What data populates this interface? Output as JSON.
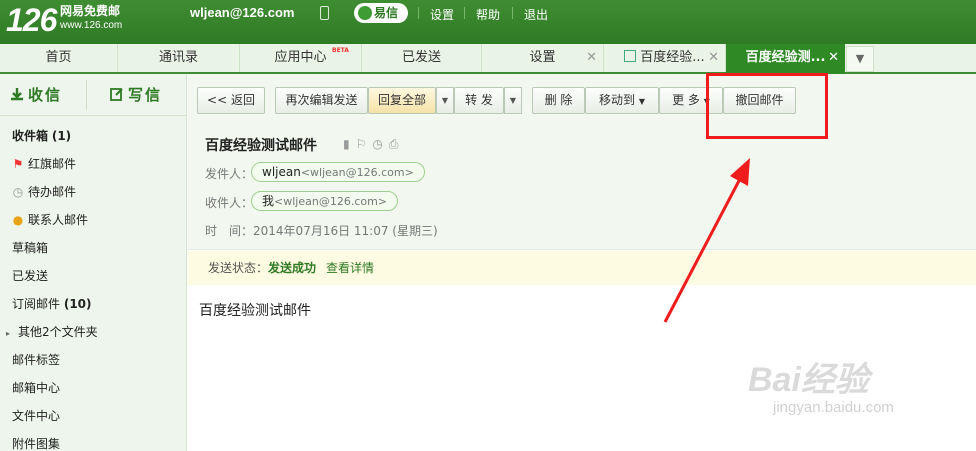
{
  "topbar": {
    "logo": "126",
    "logo_sub": "网易免费邮",
    "logo_url": "www.126.com",
    "user": "wljean@126.com",
    "yixin": "易信",
    "links": [
      "设置",
      "帮助",
      "退出"
    ]
  },
  "tabs": [
    {
      "label": "首页"
    },
    {
      "label": "通讯录"
    },
    {
      "label": "应用中心",
      "badge": "BETA"
    },
    {
      "label": "已发送"
    },
    {
      "label": "设置"
    },
    {
      "label": "百度经验..."
    },
    {
      "label": "百度经验测..."
    }
  ],
  "sidebar": {
    "receive": "收信",
    "compose": "写信",
    "folders": [
      {
        "label": "收件箱",
        "count": "(1)"
      },
      {
        "label": "红旗邮件"
      },
      {
        "label": "待办邮件"
      },
      {
        "label": "联系人邮件"
      },
      {
        "label": "草稿箱"
      },
      {
        "label": "已发送"
      },
      {
        "label": "订阅邮件",
        "count": "(10)"
      },
      {
        "label": "其他2个文件夹"
      },
      {
        "label": "邮件标签"
      },
      {
        "label": "邮箱中心"
      },
      {
        "label": "文件中心"
      },
      {
        "label": "附件图集"
      }
    ]
  },
  "toolbar": {
    "back": "<< 返回",
    "reedit": "再次编辑发送",
    "reply_all": "回复全部",
    "forward": "转 发",
    "delete": "删 除",
    "move_to": "移动到",
    "more": "更 多",
    "recall": "撤回邮件"
  },
  "mail": {
    "subject": "百度经验测试邮件",
    "from_label": "发件人：",
    "from_name": "wljean",
    "from_addr": "<wljean@126.com>",
    "to_label": "收件人：",
    "to_name": "我",
    "to_addr": "<wljean@126.com>",
    "time_label": "时　间：",
    "time_value": "2014年07月16日 11:07 (星期三)",
    "status_label": "发送状态：",
    "status_value": "发送成功",
    "status_link": "查看详情",
    "body": "百度经验测试邮件"
  },
  "watermark": {
    "text": "Bai经验",
    "url": "jingyan.baidu.com"
  },
  "colors": {
    "brand_green": "#2f7a25",
    "annotation_red": "#ee1c1c"
  }
}
